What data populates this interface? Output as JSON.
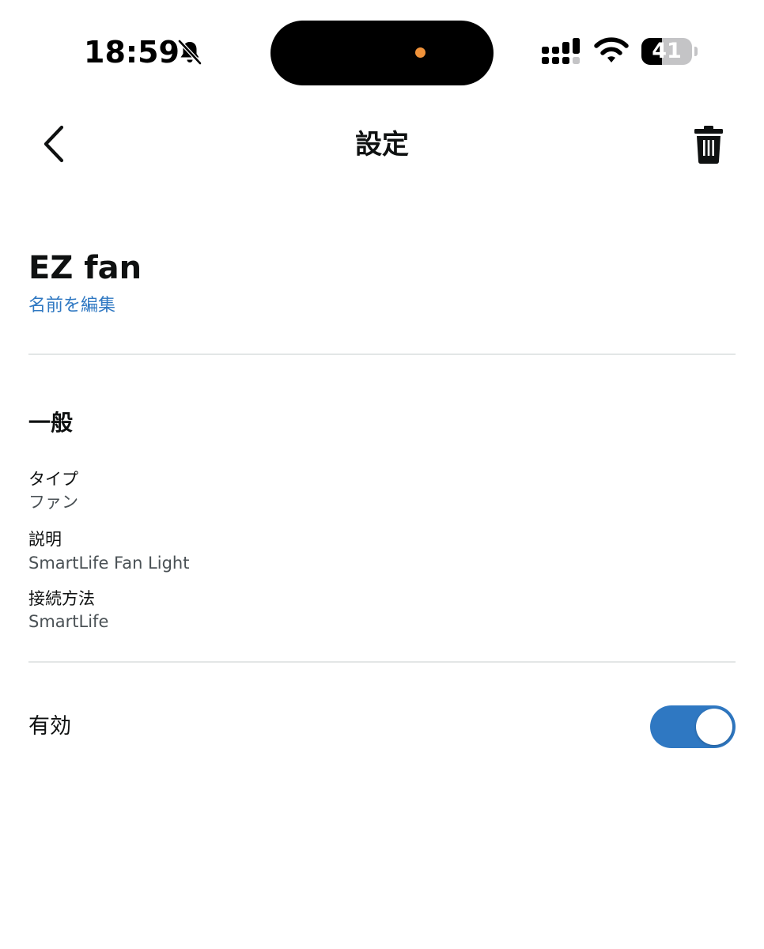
{
  "status_bar": {
    "time": "18:59",
    "battery_level": "41",
    "battery_fraction": 0.41,
    "mute_icon": "bell-slash-icon",
    "signal_icon": "cellular-signal-icon",
    "wifi_icon": "wifi-icon",
    "recording_indicator_color": "#f0923a"
  },
  "nav": {
    "title": "設定",
    "back_icon": "chevron-left-icon",
    "delete_icon": "trash-icon"
  },
  "device": {
    "name": "EZ fan",
    "rename_label": "名前を編集"
  },
  "general": {
    "title": "一般",
    "items": [
      {
        "label": "タイプ",
        "value": "ファン"
      },
      {
        "label": "説明",
        "value": "SmartLife Fan Light"
      },
      {
        "label": "接続方法",
        "value": "SmartLife"
      }
    ]
  },
  "enabled": {
    "label": "有効",
    "on": true
  },
  "colors": {
    "accent": "#2f78c2",
    "text": "#0f1111",
    "secondary_text": "#4a5155",
    "divider": "#e3e6e6"
  }
}
